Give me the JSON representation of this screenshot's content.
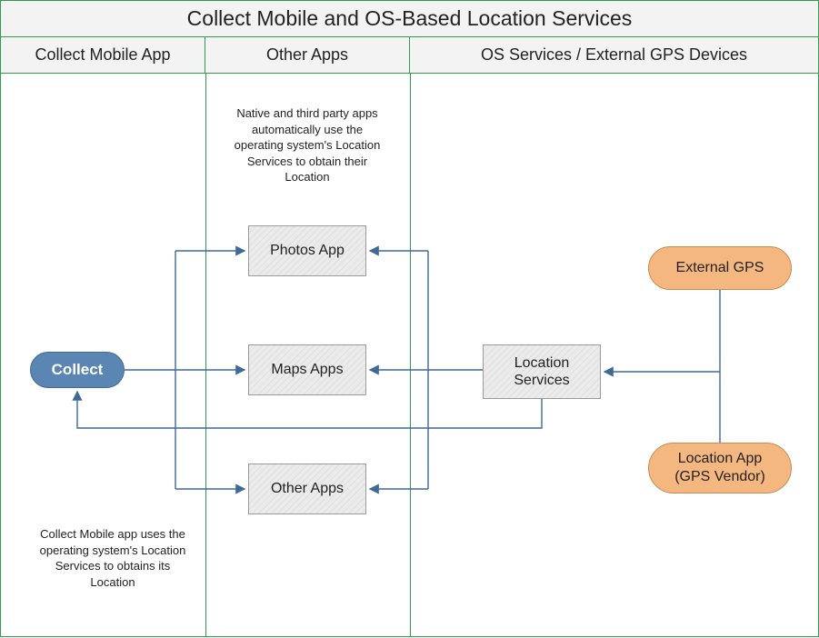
{
  "title": "Collect Mobile and OS-Based Location Services",
  "columns": {
    "col1": "Collect Mobile App",
    "col2": "Other Apps",
    "col3": "OS Services / External GPS Devices"
  },
  "notes": {
    "top": "Native and third party apps automatically use the operating system's Location Services to obtain their Location",
    "bottom": "Collect Mobile app uses the operating system's Location Services to obtains its Location"
  },
  "nodes": {
    "collect": "Collect",
    "photos": "Photos App",
    "maps": "Maps Apps",
    "other": "Other Apps",
    "location_services": "Location Services",
    "external_gps": "External GPS",
    "vendor_gps": "Location App (GPS Vendor)"
  },
  "edges": [
    {
      "from": "collect",
      "to": "photos"
    },
    {
      "from": "collect",
      "to": "maps"
    },
    {
      "from": "collect",
      "to": "other"
    },
    {
      "from": "location_services",
      "to": "photos"
    },
    {
      "from": "location_services",
      "to": "maps"
    },
    {
      "from": "location_services",
      "to": "other"
    },
    {
      "from": "location_services",
      "to": "collect"
    },
    {
      "from": "external_gps",
      "to": "location_services"
    },
    {
      "from": "vendor_gps",
      "to": "location_services"
    }
  ]
}
